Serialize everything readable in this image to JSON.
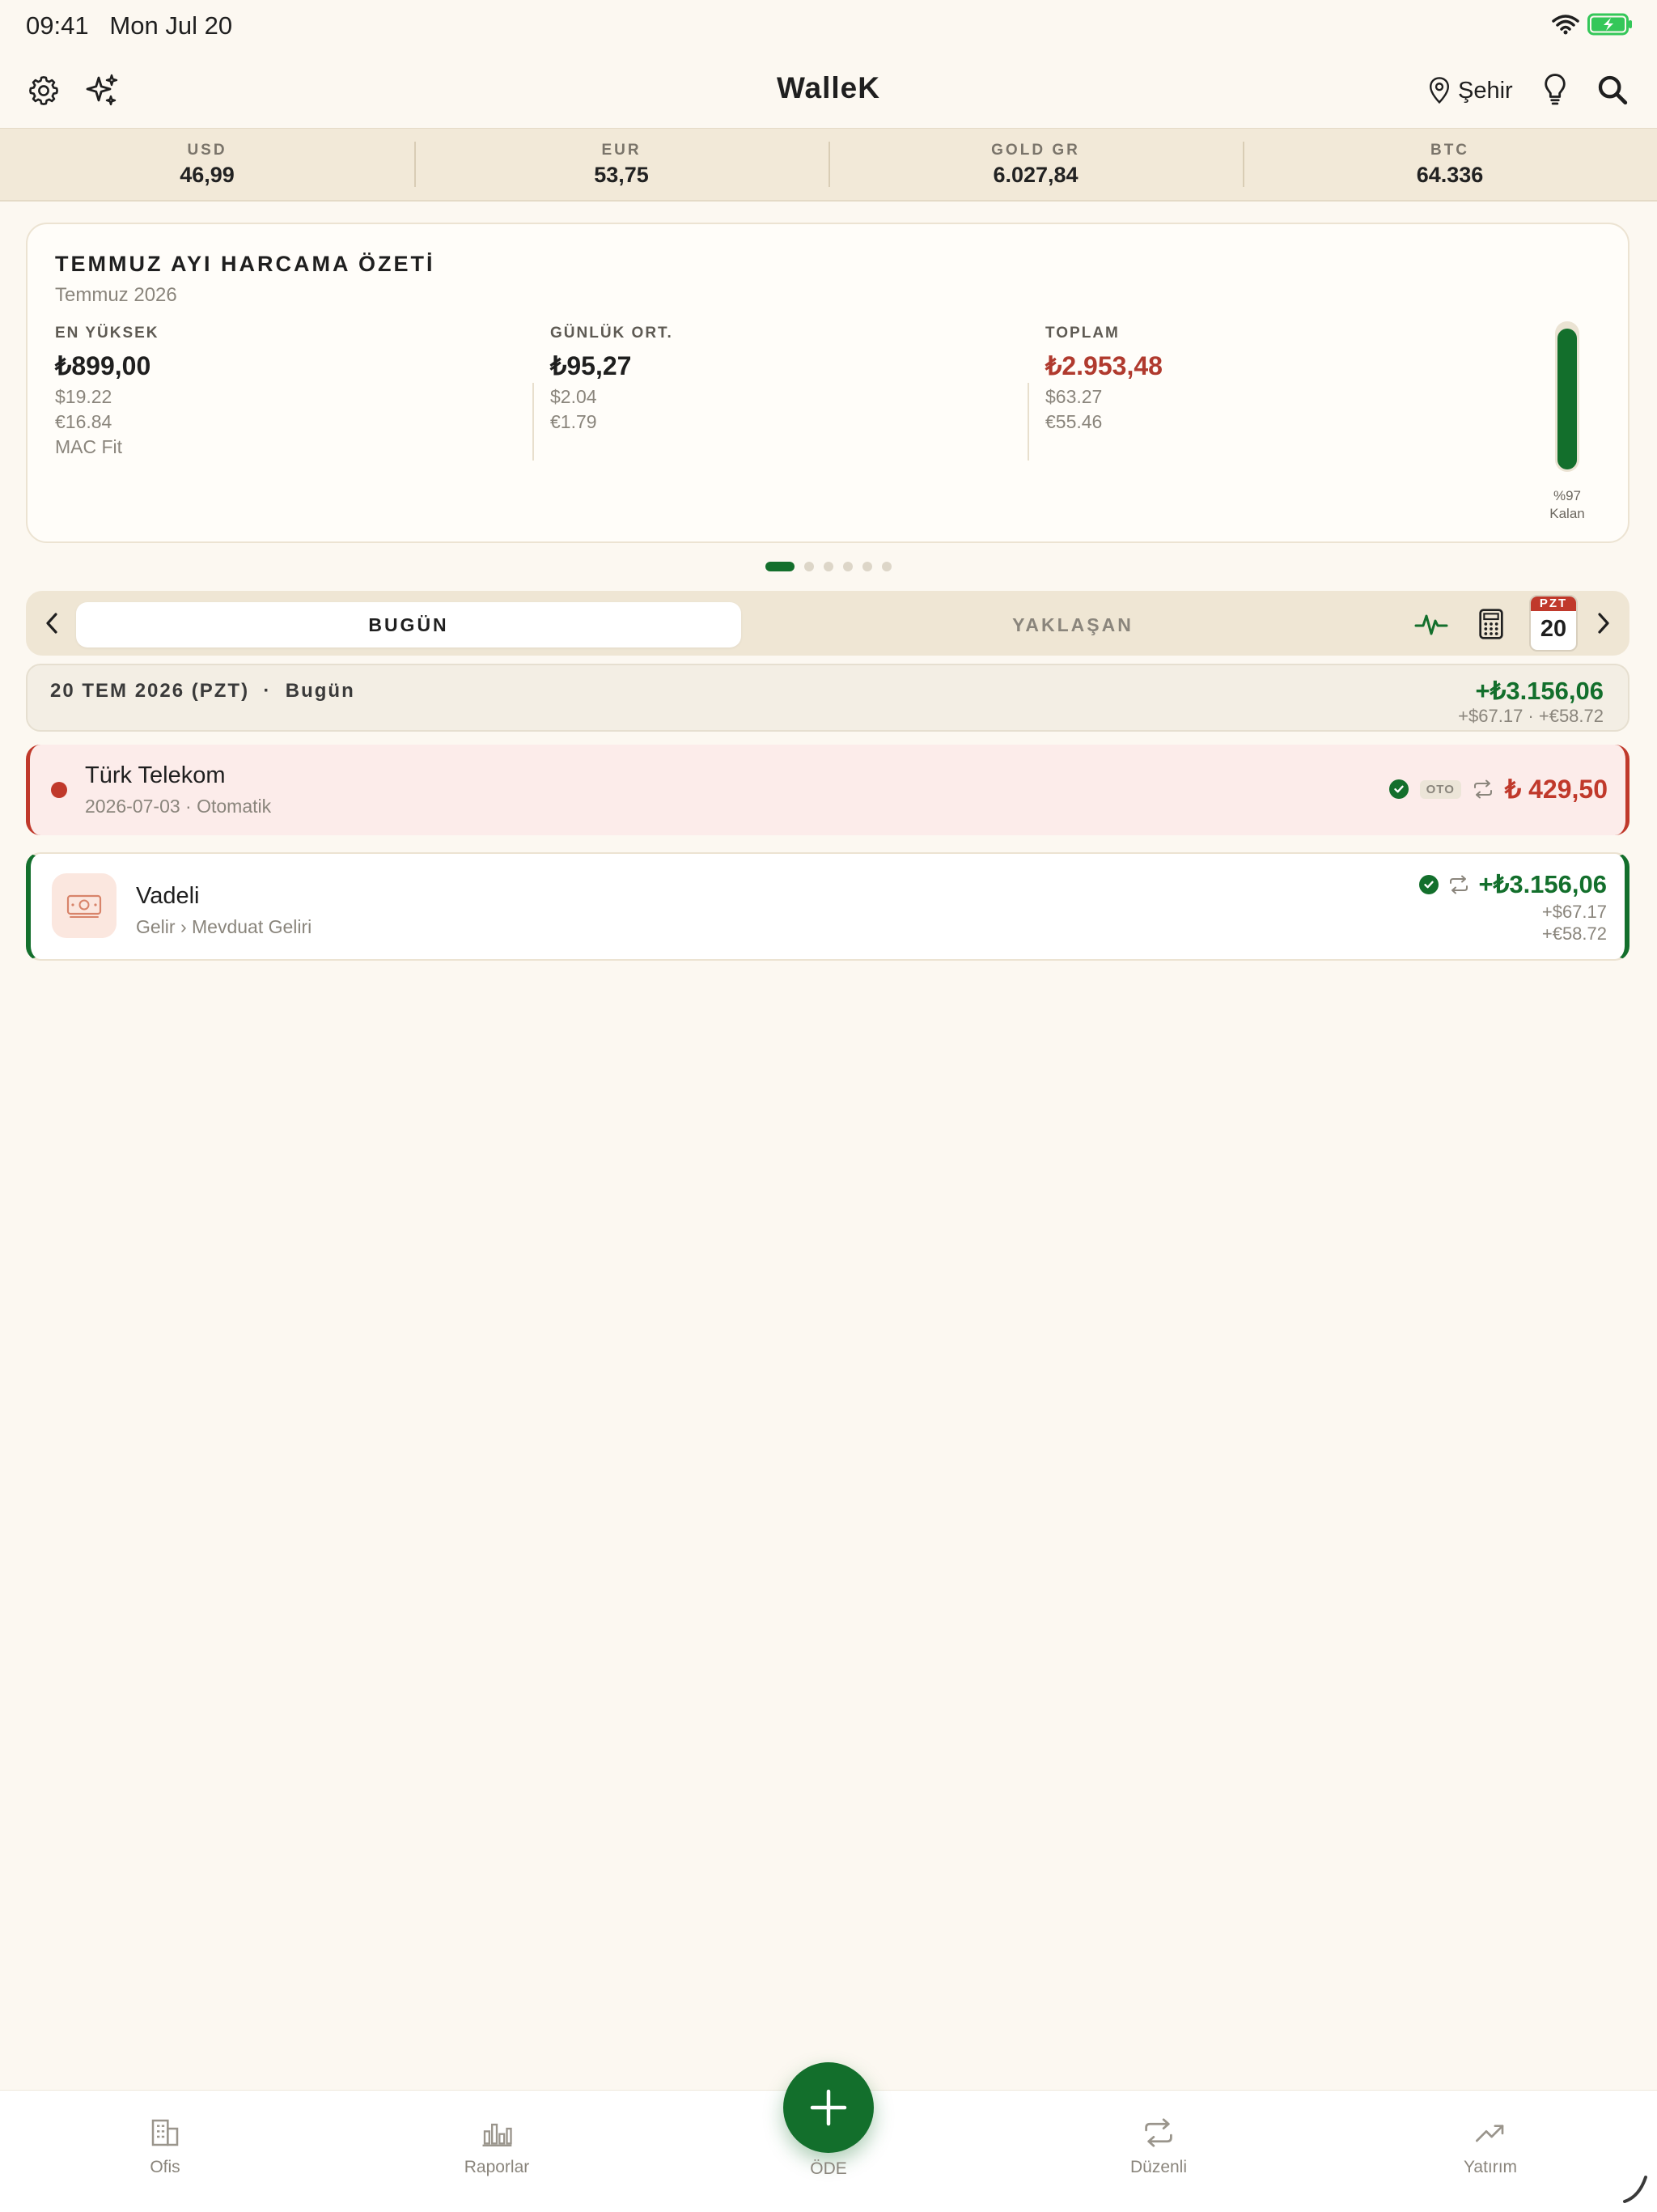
{
  "status": {
    "time": "09:41",
    "date": "Mon Jul 20"
  },
  "nav": {
    "title": "WalleK",
    "city": "Şehir"
  },
  "ticker": [
    {
      "label": "USD",
      "value": "46,99"
    },
    {
      "label": "EUR",
      "value": "53,75"
    },
    {
      "label": "GOLD GR",
      "value": "6.027,84"
    },
    {
      "label": "BTC",
      "value": "64.336"
    }
  ],
  "summary": {
    "title": "TEMMUZ AYI HARCAMA ÖZETİ",
    "subtitle": "Temmuz 2026",
    "highest": {
      "label": "EN YÜKSEK",
      "value": "₺899,00",
      "usd": "$19.22",
      "eur": "€16.84",
      "note": "MAC Fit"
    },
    "daily": {
      "label": "GÜNLÜK ORT.",
      "value": "₺95,27",
      "usd": "$2.04",
      "eur": "€1.79"
    },
    "total": {
      "label": "TOPLAM",
      "value": "₺2.953,48",
      "usd": "$63.27",
      "eur": "€55.46"
    },
    "remaining_percent": 97,
    "remaining_text": "%97",
    "remaining_label": "Kalan"
  },
  "segments": {
    "today": "BUGÜN",
    "upcoming": "YAKLAŞAN"
  },
  "calendar": {
    "weekday": "PZT",
    "day": "20"
  },
  "day_header": {
    "date": "20 TEM 2026 (PZT)",
    "separator": "·",
    "label": "Bugün",
    "amount": "+₺3.156,06",
    "sub": "+$67.17 · +€58.72"
  },
  "transactions": [
    {
      "title": "Türk Telekom",
      "subtitle": "2026-07-03 · Otomatik",
      "badge": "OTO",
      "amount": "₺ 429,50"
    },
    {
      "title": "Vadeli",
      "subtitle": "Gelir › Mevduat Geliri",
      "amount": "+₺3.156,06",
      "usd": "+$67.17",
      "eur": "+€58.72"
    }
  ],
  "tabs": {
    "office": "Ofis",
    "reports": "Raporlar",
    "pay": "ÖDE",
    "recurring": "Düzenli",
    "invest": "Yatırım"
  },
  "colors": {
    "accent": "#136f2c",
    "expense": "#c0392b",
    "background": "#fcf8f1"
  }
}
